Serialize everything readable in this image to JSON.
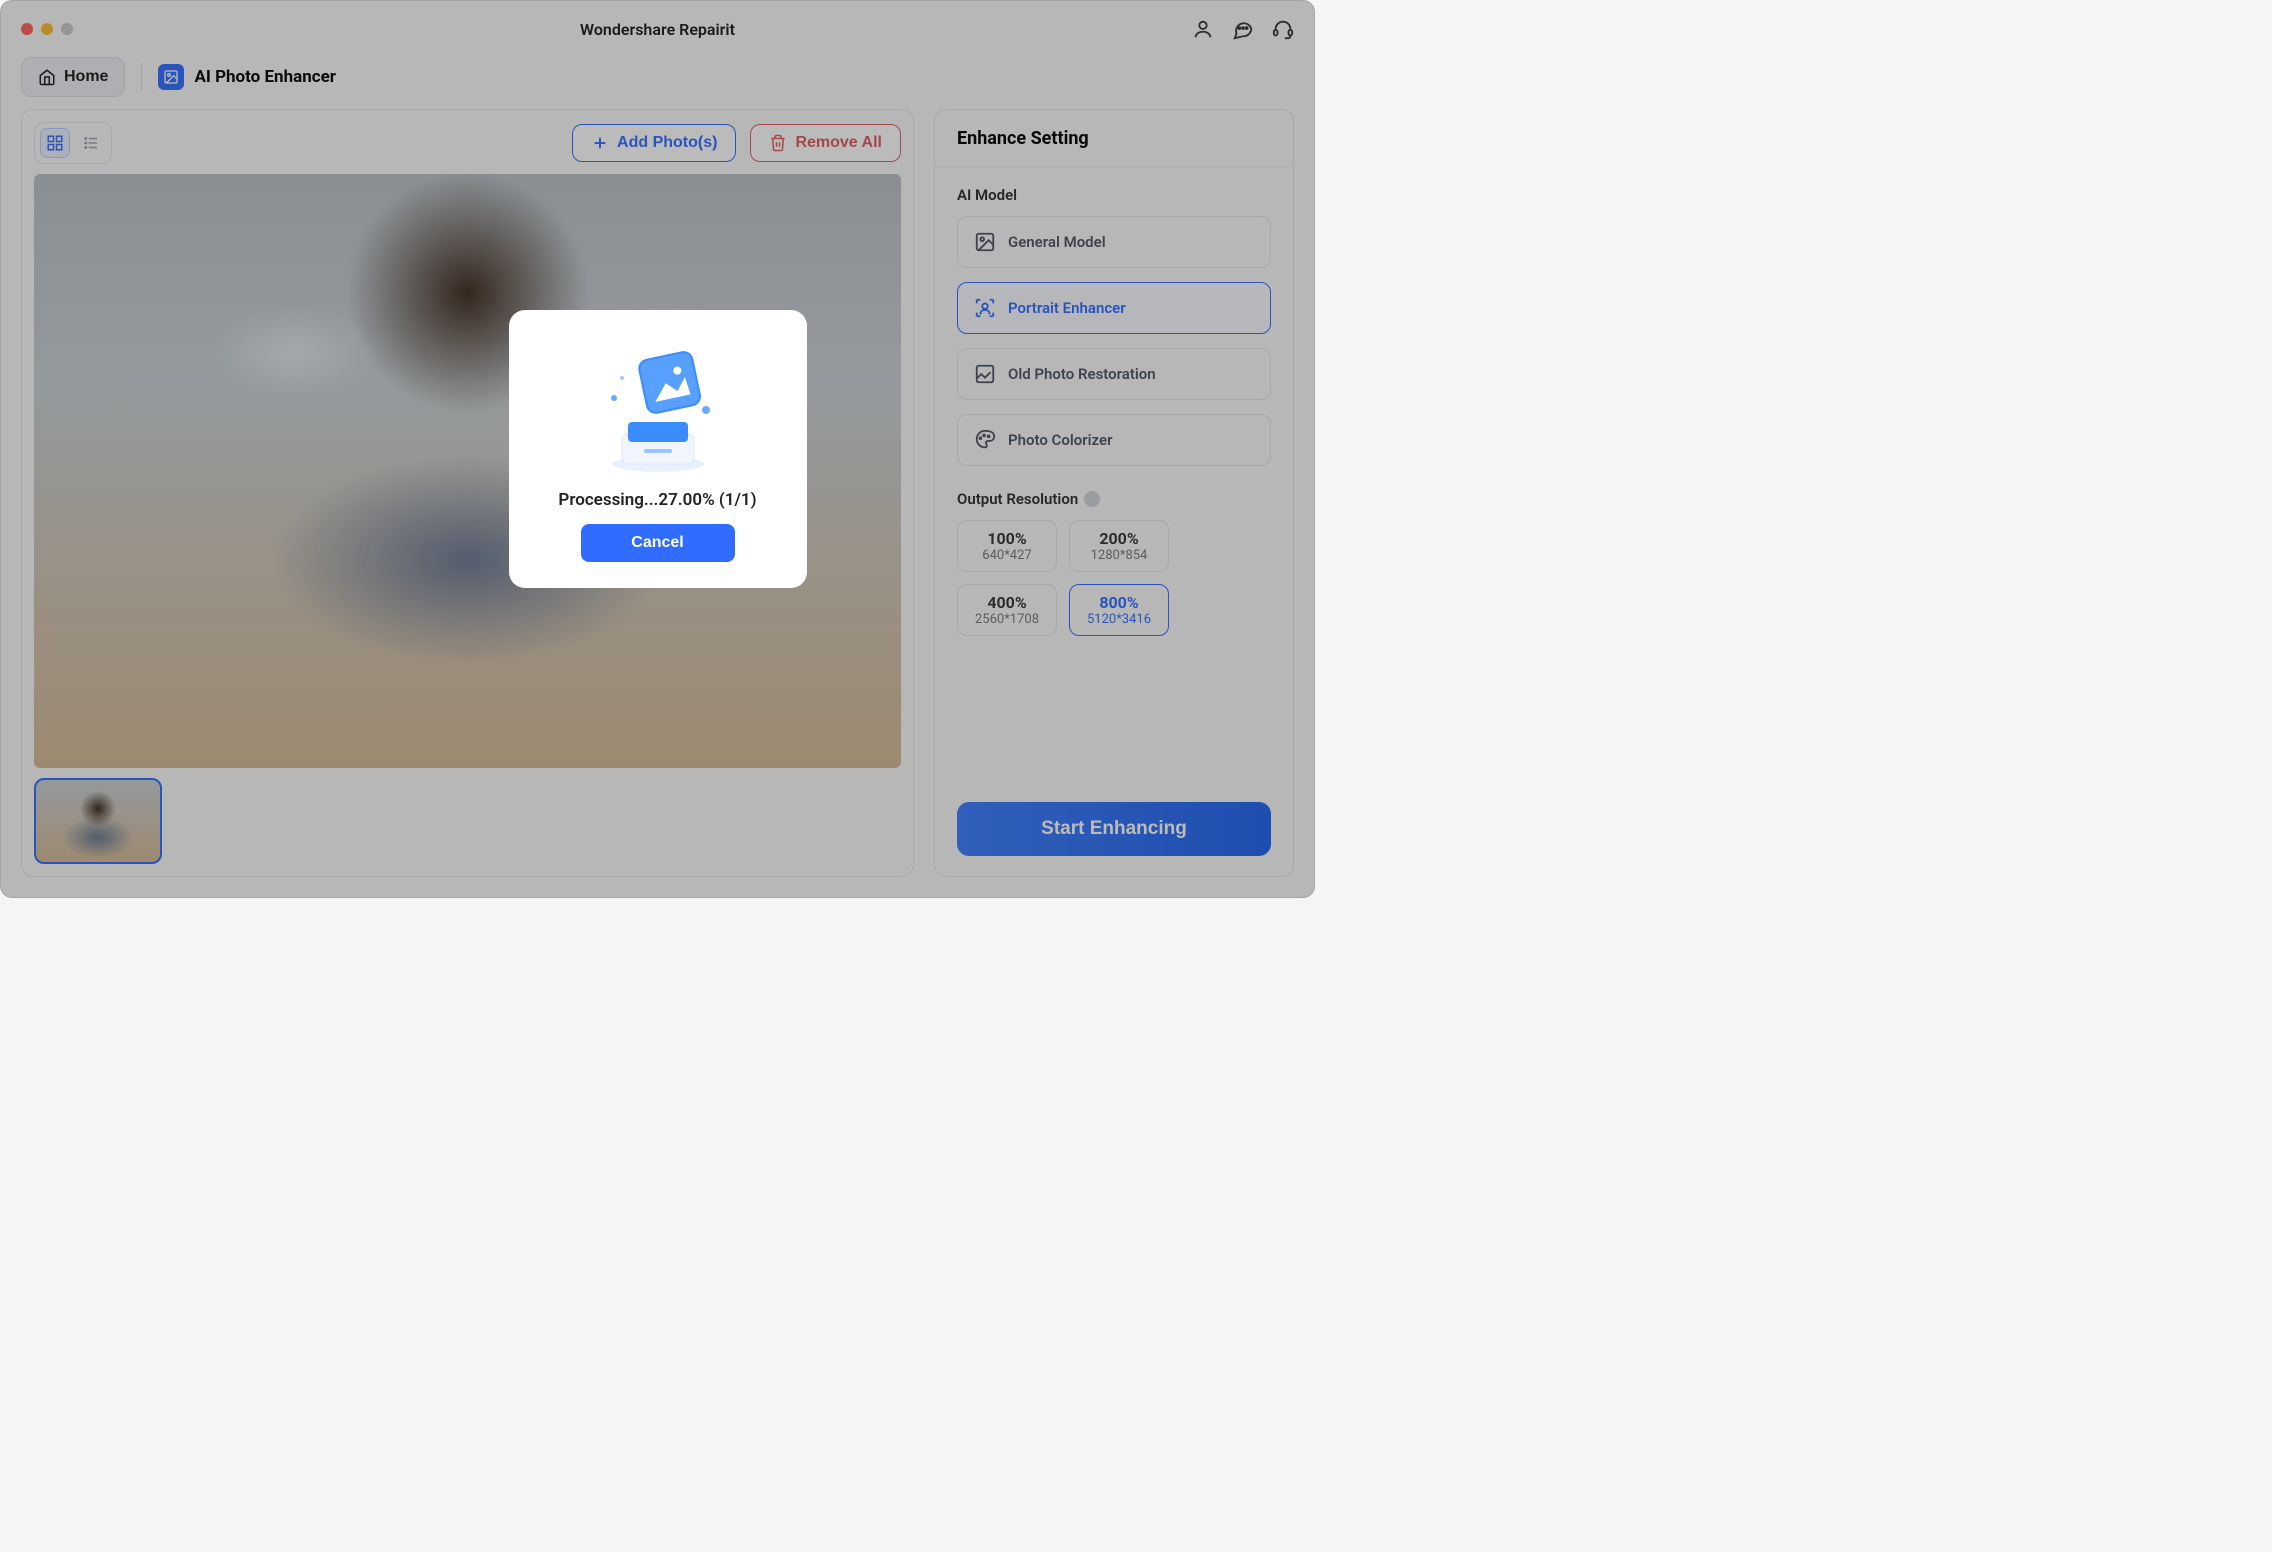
{
  "app_title": "Wondershare Repairit",
  "nav": {
    "home_label": "Home",
    "page_label": "AI Photo Enhancer"
  },
  "toolbar": {
    "add_label": "Add Photo(s)",
    "remove_label": "Remove All"
  },
  "settings": {
    "header": "Enhance Setting",
    "ai_model_label": "AI Model",
    "models": [
      {
        "label": "General Model"
      },
      {
        "label": "Portrait Enhancer"
      },
      {
        "label": "Old Photo Restoration"
      },
      {
        "label": "Photo Colorizer"
      }
    ],
    "selected_model_index": 1,
    "output_label": "Output Resolution",
    "resolutions": [
      {
        "percent": "100%",
        "dim": "640*427"
      },
      {
        "percent": "200%",
        "dim": "1280*854"
      },
      {
        "percent": "400%",
        "dim": "2560*1708"
      },
      {
        "percent": "800%",
        "dim": "5120*3416"
      }
    ],
    "selected_res_index": 3,
    "start_label": "Start Enhancing"
  },
  "modal": {
    "status": "Processing...27.00% (1/1)",
    "cancel_label": "Cancel"
  }
}
